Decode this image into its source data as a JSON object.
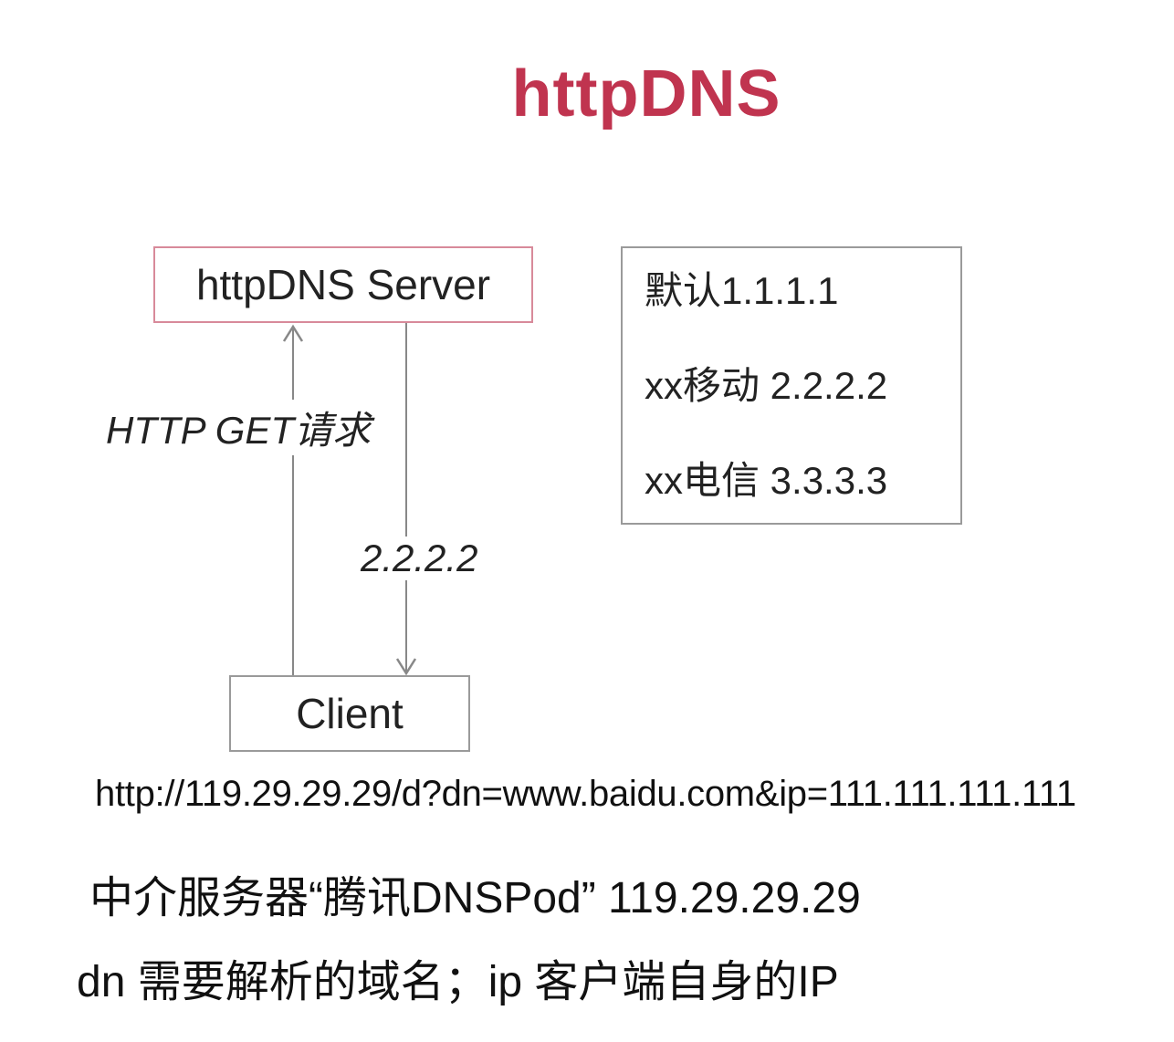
{
  "title": "httpDNS",
  "nodes": {
    "server": "httpDNS Server",
    "client": "Client"
  },
  "edges": {
    "request_label": "HTTP GET请求",
    "response_label": "2.2.2.2"
  },
  "mapping": [
    "默认1.1.1.1",
    "xx移动 2.2.2.2",
    "xx电信 3.3.3.3"
  ],
  "url": "http://119.29.29.29/d?dn=www.baidu.com&ip=111.111.111.111",
  "notes": [
    "中介服务器“腾讯DNSPod” 119.29.29.29",
    "dn 需要解析的域名；ip 客户端自身的IP"
  ],
  "colors": {
    "title": "#c0344f",
    "server_border": "#d88a9a",
    "box_border": "#9a9a9a",
    "arrow": "#888888"
  }
}
